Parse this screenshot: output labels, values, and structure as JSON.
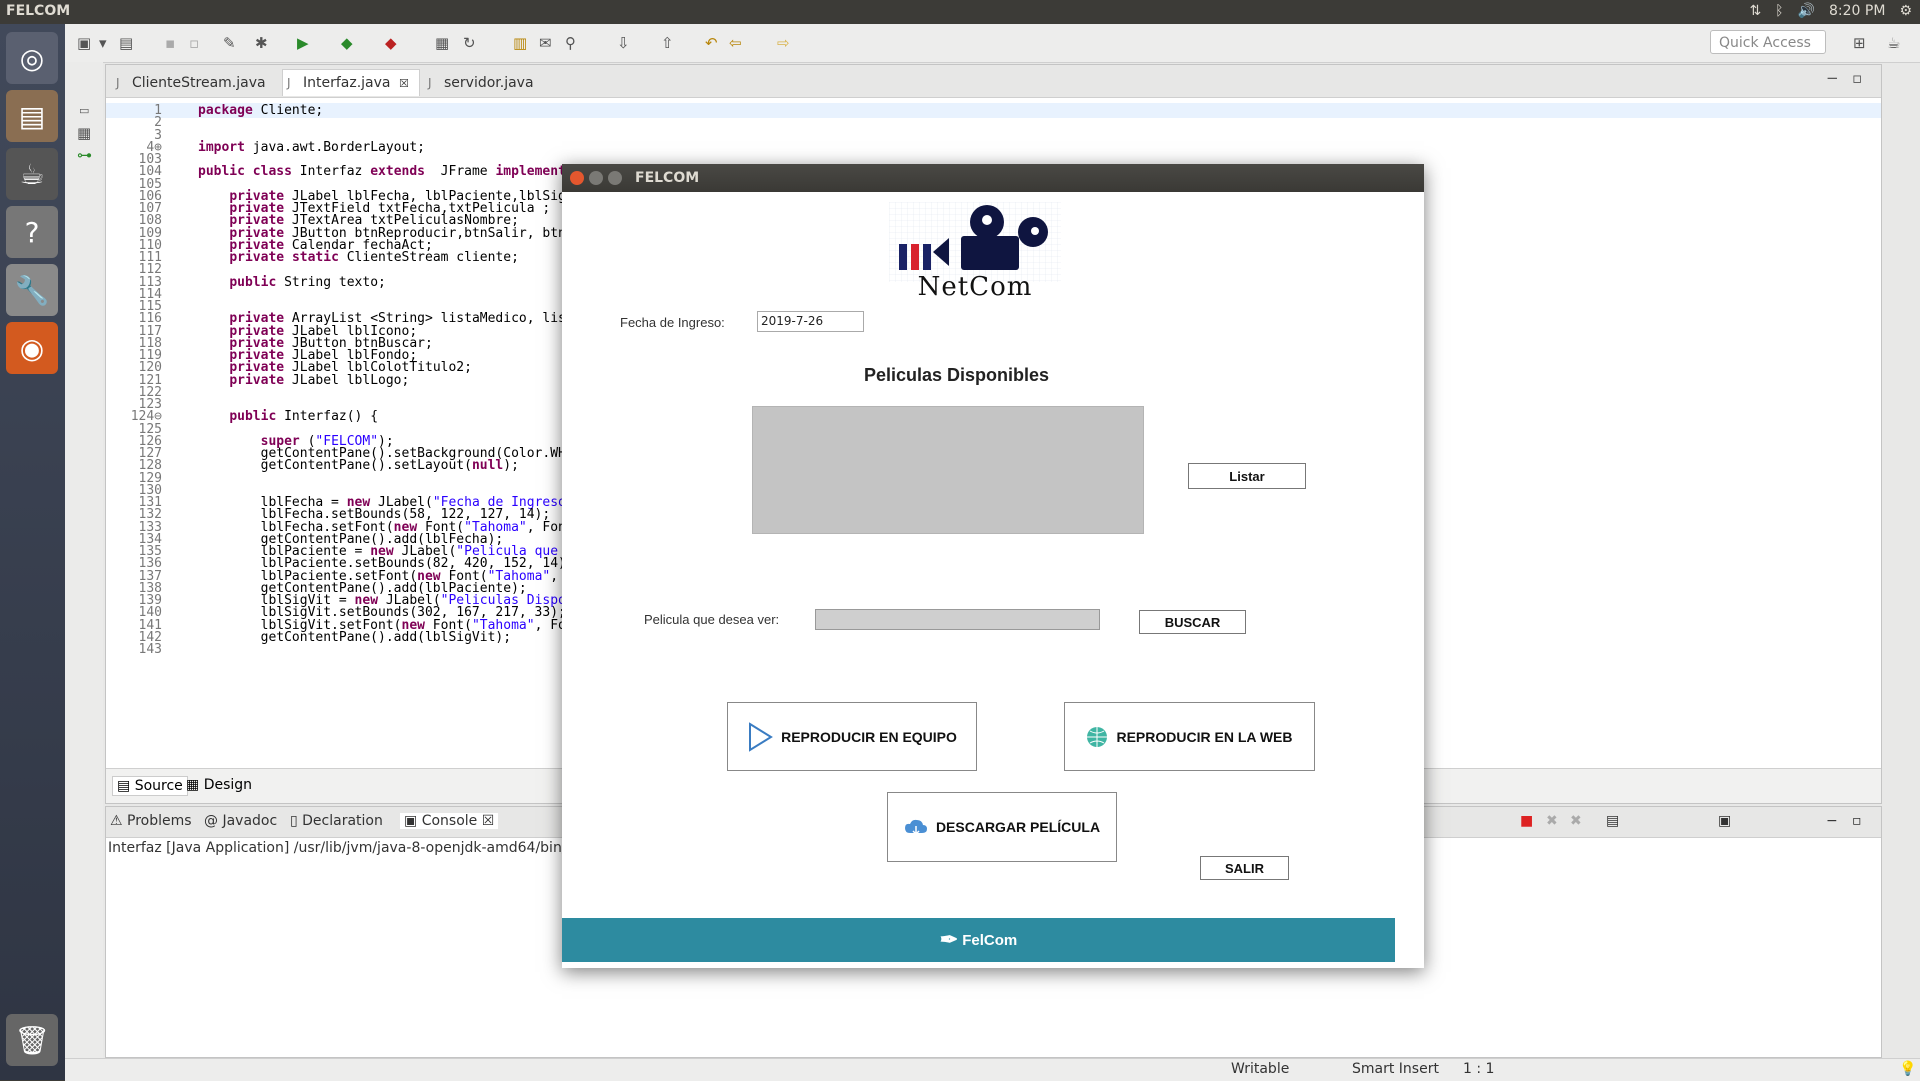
{
  "topbar": {
    "title": "FELCOM",
    "clock": "8:20 PM"
  },
  "eclipse": {
    "quick_access": "Quick Access",
    "tabs": [
      {
        "label": "ClienteStream.java"
      },
      {
        "label": "Interfaz.java",
        "close": "☒"
      },
      {
        "label": "servidor.java"
      }
    ],
    "code": [
      {
        "n": "1",
        "t": "package Cliente;"
      },
      {
        "n": "2",
        "t": ""
      },
      {
        "n": "3",
        "t": ""
      },
      {
        "n": "4⊕",
        "t": "import java.awt.BorderLayout;"
      },
      {
        "n": "103",
        "t": ""
      },
      {
        "n": "104",
        "t": "public class Interfaz extends  JFrame implements Ac"
      },
      {
        "n": "105",
        "t": ""
      },
      {
        "n": "106",
        "t": "    private JLabel lblFecha, lblPaciente,lblSigVit"
      },
      {
        "n": "107",
        "t": "    private JTextField txtFecha,txtPelicula ;"
      },
      {
        "n": "108",
        "t": "    private JTextArea txtPeliculasNombre;"
      },
      {
        "n": "109",
        "t": "    private JButton btnReproducir,btnSalir, btnList"
      },
      {
        "n": "110",
        "t": "    private Calendar fechaAct;"
      },
      {
        "n": "111",
        "t": "    private static ClienteStream cliente;"
      },
      {
        "n": "112",
        "t": ""
      },
      {
        "n": "113",
        "t": "    public String texto;"
      },
      {
        "n": "114",
        "t": ""
      },
      {
        "n": "115",
        "t": ""
      },
      {
        "n": "116",
        "t": "    private ArrayList <String> listaMedico, listaPa"
      },
      {
        "n": "117",
        "t": "    private JLabel lblIcono;"
      },
      {
        "n": "118",
        "t": "    private JButton btnBuscar;"
      },
      {
        "n": "119",
        "t": "    private JLabel lblFondo;"
      },
      {
        "n": "120",
        "t": "    private JLabel lblColotTitulo2;"
      },
      {
        "n": "121",
        "t": "    private JLabel lblLogo;"
      },
      {
        "n": "122",
        "t": ""
      },
      {
        "n": "123",
        "t": ""
      },
      {
        "n": "124⊖",
        "t": "    public Interfaz() {"
      },
      {
        "n": "125",
        "t": ""
      },
      {
        "n": "126",
        "t": "        super (\"FELCOM\");"
      },
      {
        "n": "127",
        "t": "        getContentPane().setBackground(Color.WHITE)"
      },
      {
        "n": "128",
        "t": "        getContentPane().setLayout(null);"
      },
      {
        "n": "129",
        "t": ""
      },
      {
        "n": "130",
        "t": ""
      },
      {
        "n": "131",
        "t": "        lblFecha = new JLabel(\"Fecha de Ingreso:\");"
      },
      {
        "n": "132",
        "t": "        lblFecha.setBounds(58, 122, 127, 14);"
      },
      {
        "n": "133",
        "t": "        lblFecha.setFont(new Font(\"Tahoma\", Font.PL"
      },
      {
        "n": "134",
        "t": "        getContentPane().add(lblFecha);"
      },
      {
        "n": "135",
        "t": "        lblPaciente = new JLabel(\"Pelicula que dese"
      },
      {
        "n": "136",
        "t": "        lblPaciente.setBounds(82, 420, 152, 14);"
      },
      {
        "n": "137",
        "t": "        lblPaciente.setFont(new Font(\"Tahoma\", Font"
      },
      {
        "n": "138",
        "t": "        getContentPane().add(lblPaciente);"
      },
      {
        "n": "139",
        "t": "        lblSigVit = new JLabel(\"Peliculas Disponibl"
      },
      {
        "n": "140",
        "t": "        lblSigVit.setBounds(302, 167, 217, 33);"
      },
      {
        "n": "141",
        "t": "        lblSigVit.setFont(new Font(\"Tahoma\", Font.B"
      },
      {
        "n": "142",
        "t": "        getContentPane().add(lblSigVit);"
      },
      {
        "n": "143",
        "t": ""
      }
    ],
    "source_tab": "Source",
    "design_tab": "Design",
    "console_tabs": [
      "Problems",
      "Javadoc",
      "Declaration",
      "Console"
    ],
    "console_path": "Interfaz [Java Application] /usr/lib/jvm/java-8-openjdk-amd64/bin/",
    "status": {
      "writable": "Writable",
      "insert": "Smart Insert",
      "pos": "1 : 1"
    }
  },
  "dialog": {
    "title": "FELCOM",
    "logo_text": "NetCom",
    "fecha_label": "Fecha de Ingreso:",
    "fecha_value": "2019-7-26",
    "peliculas_title": "Peliculas Disponibles",
    "listar": "Listar",
    "pelicula_label": "Pelicula que desea ver:",
    "buscar": "BUSCAR",
    "reproducir_equipo": "REPRODUCIR EN EQUIPO",
    "reproducir_web": "REPRODUCIR EN LA WEB",
    "descargar": "DESCARGAR PELÍCULA",
    "salir": "SALIR",
    "footer": "FelCom"
  }
}
